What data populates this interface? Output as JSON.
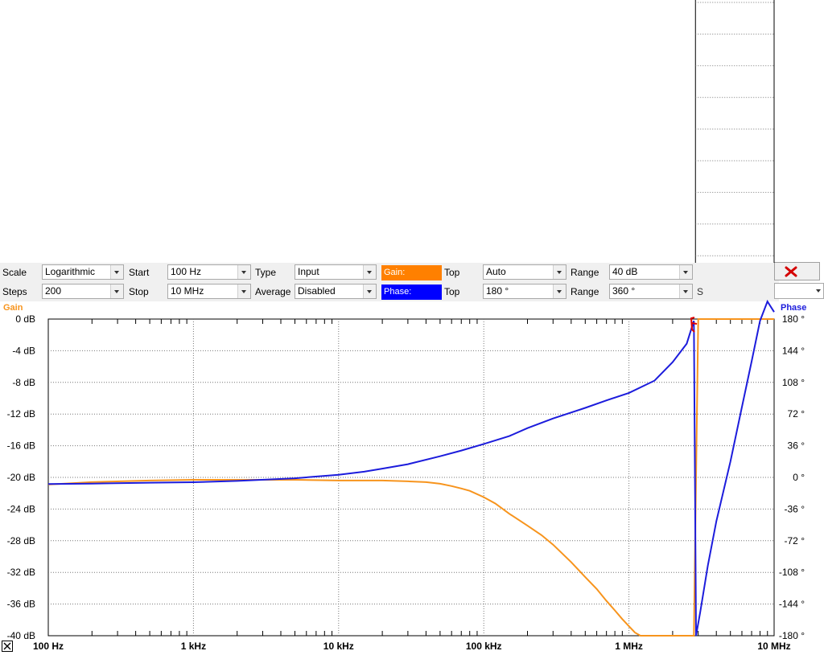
{
  "toolbar": {
    "scale_label": "Scale",
    "scale_value": "Logarithmic",
    "steps_label": "Steps",
    "steps_value": "200",
    "start_label": "Start",
    "start_value": "100 Hz",
    "stop_label": "Stop",
    "stop_value": "10 MHz",
    "type_label": "Type",
    "type_value": "Input",
    "average_label": "Average",
    "average_value": "Disabled",
    "gain_swatch": "Gain:",
    "phase_swatch": "Phase:",
    "gain_top_label": "Top",
    "gain_top_value": "Auto",
    "phase_top_label": "Top",
    "phase_top_value": "180 °",
    "gain_range_label": "Range",
    "gain_range_value": "40 dB",
    "phase_range_label": "Range",
    "phase_range_value": "360 °",
    "partial_label": "S"
  },
  "colors": {
    "gain": "#f7941d",
    "phase": "#1c1cdc",
    "gain_swatch": "#ff8000",
    "phase_swatch": "#0000ff",
    "marker": "#e00000",
    "close": "#d40000"
  },
  "icons": {
    "close": "close-x-icon",
    "marker": "marker-bracket-icon",
    "corner": "corner-x-icon"
  },
  "chart_data": {
    "type": "line",
    "title": "",
    "left_axis_title": "Gain",
    "right_axis_title": "Phase",
    "x_scale": "log",
    "xlim": [
      100,
      10000000
    ],
    "x_ticks": [
      "100 Hz",
      "1 kHz",
      "10 kHz",
      "100 kHz",
      "1 MHz",
      "10 MHz"
    ],
    "gain_ylim": [
      -40,
      0
    ],
    "gain_ticks": [
      "0 dB",
      "-4 dB",
      "-8 dB",
      "-12 dB",
      "-16 dB",
      "-20 dB",
      "-24 dB",
      "-28 dB",
      "-32 dB",
      "-36 dB",
      "-40 dB"
    ],
    "phase_ylim": [
      -180,
      180
    ],
    "phase_ticks": [
      "180 °",
      "144 °",
      "108 °",
      "72 °",
      "36 °",
      "0 °",
      "-36 °",
      "-72 °",
      "-108 °",
      "-144 °",
      "-180 °"
    ],
    "grid": true,
    "series": [
      {
        "name": "Gain",
        "axis": "left",
        "x": [
          100,
          200,
          500,
          1000,
          2000,
          5000,
          10000,
          20000,
          30000,
          40000,
          50000,
          60000,
          70000,
          80000,
          100000,
          120000,
          150000,
          200000,
          250000,
          300000,
          400000,
          500000,
          600000,
          700000,
          800000,
          900000,
          1000000,
          1100000,
          1200000,
          2800000,
          3000000,
          5000000,
          10000000
        ],
        "y": [
          -20.9,
          -20.6,
          -20.4,
          -20.3,
          -20.3,
          -20.3,
          -20.4,
          -20.4,
          -20.5,
          -20.6,
          -20.8,
          -21.1,
          -21.4,
          -21.7,
          -22.5,
          -23.3,
          -24.6,
          -26.1,
          -27.3,
          -28.5,
          -30.7,
          -32.6,
          -34.1,
          -35.6,
          -36.8,
          -37.9,
          -38.8,
          -39.6,
          -40.0,
          -40.0,
          0.0,
          0.0,
          0.0
        ]
      },
      {
        "name": "Phase",
        "axis": "right",
        "x": [
          100,
          200,
          500,
          1000,
          2000,
          5000,
          10000,
          15000,
          20000,
          30000,
          50000,
          70000,
          100000,
          150000,
          200000,
          300000,
          500000,
          700000,
          1000000,
          1500000,
          2000000,
          2500000,
          2800000,
          2900000,
          3100000,
          3500000,
          4000000,
          5000000,
          6000000,
          7000000,
          8000000,
          9000000,
          10000000
        ],
        "y": [
          -7.5,
          -7,
          -6,
          -5.5,
          -4,
          -1,
          3,
          6.5,
          10,
          15,
          24,
          30.5,
          38,
          47,
          56,
          67,
          79,
          87.5,
          96,
          110,
          131,
          152,
          178,
          -180,
          -153,
          -100,
          -50,
          18,
          80,
          132,
          178,
          200,
          188
        ]
      }
    ]
  }
}
